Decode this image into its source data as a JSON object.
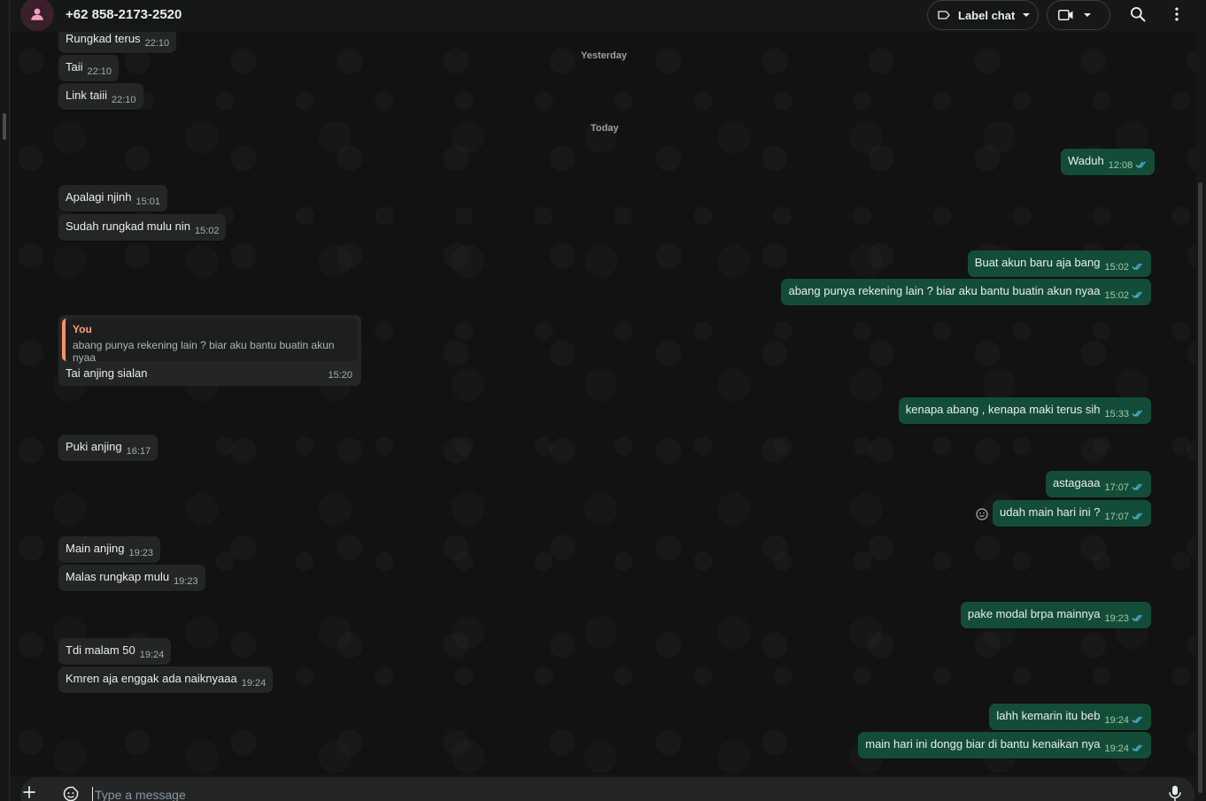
{
  "header": {
    "contact_name": "+62 858-2173-2520",
    "label_chat": "Label chat"
  },
  "day_chips": {
    "yesterday": "Yesterday",
    "today": "Today"
  },
  "incoming": [
    {
      "text": "Rungkad terus",
      "time": "22:10"
    },
    {
      "text": "Taii",
      "time": "22:10"
    },
    {
      "text": "Link taiii",
      "time": "22:10"
    },
    {
      "text": "Apalagi njinh",
      "time": "15:01"
    },
    {
      "text": "Sudah rungkad mulu nin",
      "time": "15:02"
    },
    {
      "text": "Puki anjing",
      "time": "16:17"
    },
    {
      "text": "Main anjing",
      "time": "19:23"
    },
    {
      "text": "Malas rungkap mulu",
      "time": "19:23"
    },
    {
      "text": "Tdi malam 50",
      "time": "19:24"
    },
    {
      "text": "Kmren aja enggak ada naiknyaaa",
      "time": "19:24"
    }
  ],
  "quoted_reply": {
    "quoted_author": "You",
    "quoted_text": "abang punya rekening lain ? biar aku bantu buatin akun nyaa",
    "text": "Tai anjing sialan",
    "time": "15:20"
  },
  "outgoing": [
    {
      "text": "Waduh",
      "time": "12:08"
    },
    {
      "text": "Buat akun baru aja bang",
      "time": "15:02"
    },
    {
      "text": "abang punya rekening lain ? biar aku bantu buatin akun nyaa",
      "time": "15:02"
    },
    {
      "text": "kenapa abang , kenapa maki terus sih",
      "time": "15:33"
    },
    {
      "text": "astagaaa",
      "time": "17:07"
    },
    {
      "text": "udah main hari ini ?",
      "time": "17:07"
    },
    {
      "text": "pake modal brpa mainnya",
      "time": "19:23"
    },
    {
      "text": "lahh kemarin itu beb",
      "time": "19:24"
    },
    {
      "text": "main hari ini dongg biar di bantu kenaikan nya",
      "time": "19:24"
    }
  ],
  "composer": {
    "placeholder": "Type a message"
  },
  "colors": {
    "outgoing_bubble": "#144d37",
    "incoming_bubble": "#242626",
    "quote_accent": "#ff8f6b",
    "read_tick": "#53bdeb"
  }
}
